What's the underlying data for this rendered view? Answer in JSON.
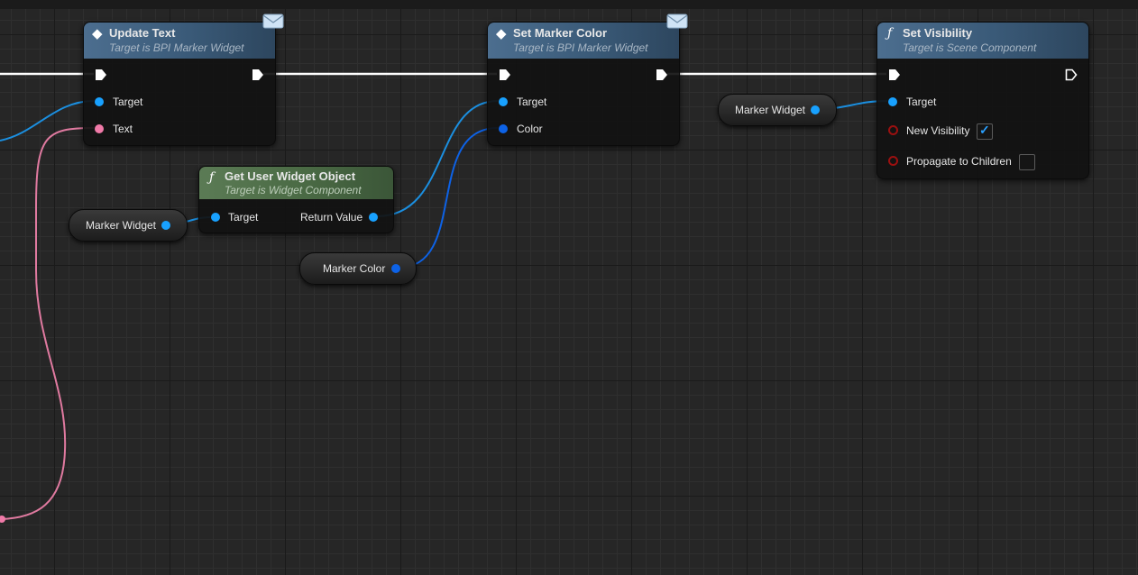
{
  "nodes": {
    "update_text": {
      "title": "Update Text",
      "subtitle": "Target is BPI Marker Widget",
      "icon": "interface-message-icon",
      "pins": {
        "target": "Target",
        "text": "Text"
      }
    },
    "set_marker_color": {
      "title": "Set Marker Color",
      "subtitle": "Target is BPI Marker Widget",
      "icon": "interface-message-icon",
      "pins": {
        "target": "Target",
        "color": "Color"
      }
    },
    "set_visibility": {
      "title": "Set Visibility",
      "subtitle": "Target is Scene Component",
      "icon": "function-icon",
      "pins": {
        "target": "Target",
        "new_visibility": "New Visibility",
        "propagate": "Propagate to Children"
      },
      "new_visibility_checked": true,
      "propagate_checked": false
    },
    "get_user_widget_object": {
      "title": "Get User Widget Object",
      "subtitle": "Target is Widget Component",
      "icon": "function-icon",
      "pins": {
        "target": "Target",
        "return_value": "Return Value"
      }
    }
  },
  "variables": {
    "marker_widget_a": "Marker Widget",
    "marker_widget_b": "Marker Widget",
    "marker_color": "Marker Color"
  },
  "colors": {
    "object_pin": "#18a1ff",
    "text_pin": "#f07aa8",
    "struct_pin": "#0d62e6",
    "bool_pin": "#9a1010",
    "exec_wire": "#ffffff"
  }
}
